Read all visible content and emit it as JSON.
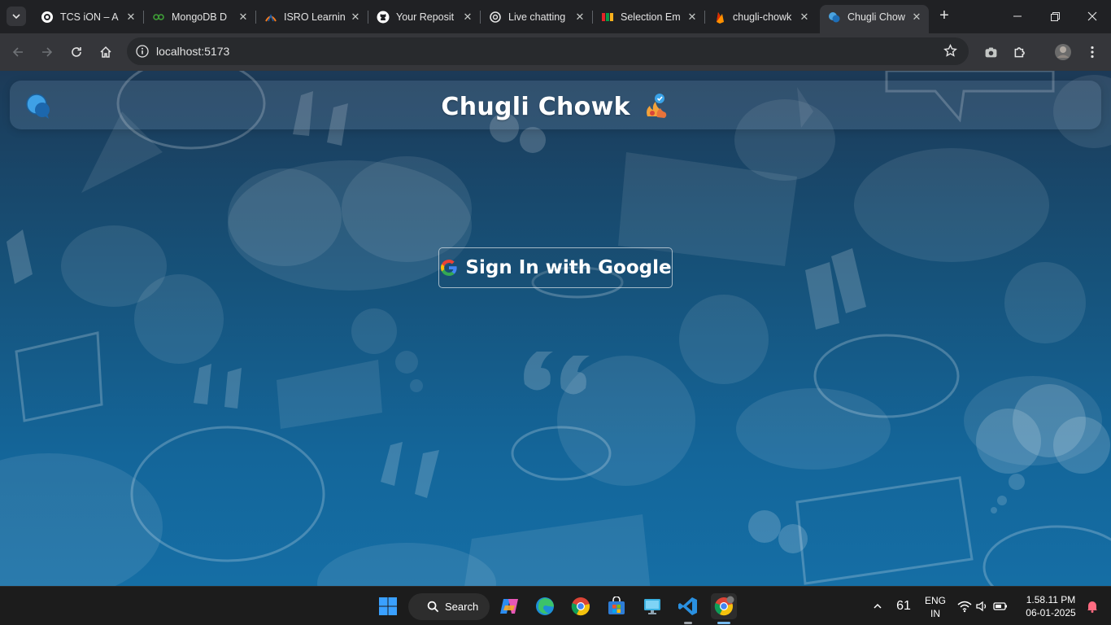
{
  "browser": {
    "tabs": [
      {
        "title": "TCS iON – A",
        "icon": "tcs-icon"
      },
      {
        "title": "MongoDB D",
        "icon": "mongodb-icon"
      },
      {
        "title": "ISRO Learnin",
        "icon": "isro-icon"
      },
      {
        "title": "Your Reposit",
        "icon": "github-icon"
      },
      {
        "title": "Live chatting",
        "icon": "chatgpt-icon"
      },
      {
        "title": "Selection Em",
        "icon": "zoho-icon"
      },
      {
        "title": "chugli-chowk",
        "icon": "firebase-icon"
      },
      {
        "title": "Chugli Chow",
        "icon": "chat-bubbles-icon",
        "active": true
      }
    ],
    "address": "localhost:5173"
  },
  "app": {
    "title": "Chugli Chowk",
    "signin_label": "Sign In with Google"
  },
  "taskbar": {
    "search_label": "Search",
    "tray": {
      "temperature": "61",
      "lang_line1": "ENG",
      "lang_line2": "IN",
      "time": "1.58.11 PM",
      "date": "06-01-2025"
    }
  },
  "colors": {
    "accent": "#76b9ed",
    "page_top": "#1c3a57",
    "page_bottom": "#156ea5"
  }
}
